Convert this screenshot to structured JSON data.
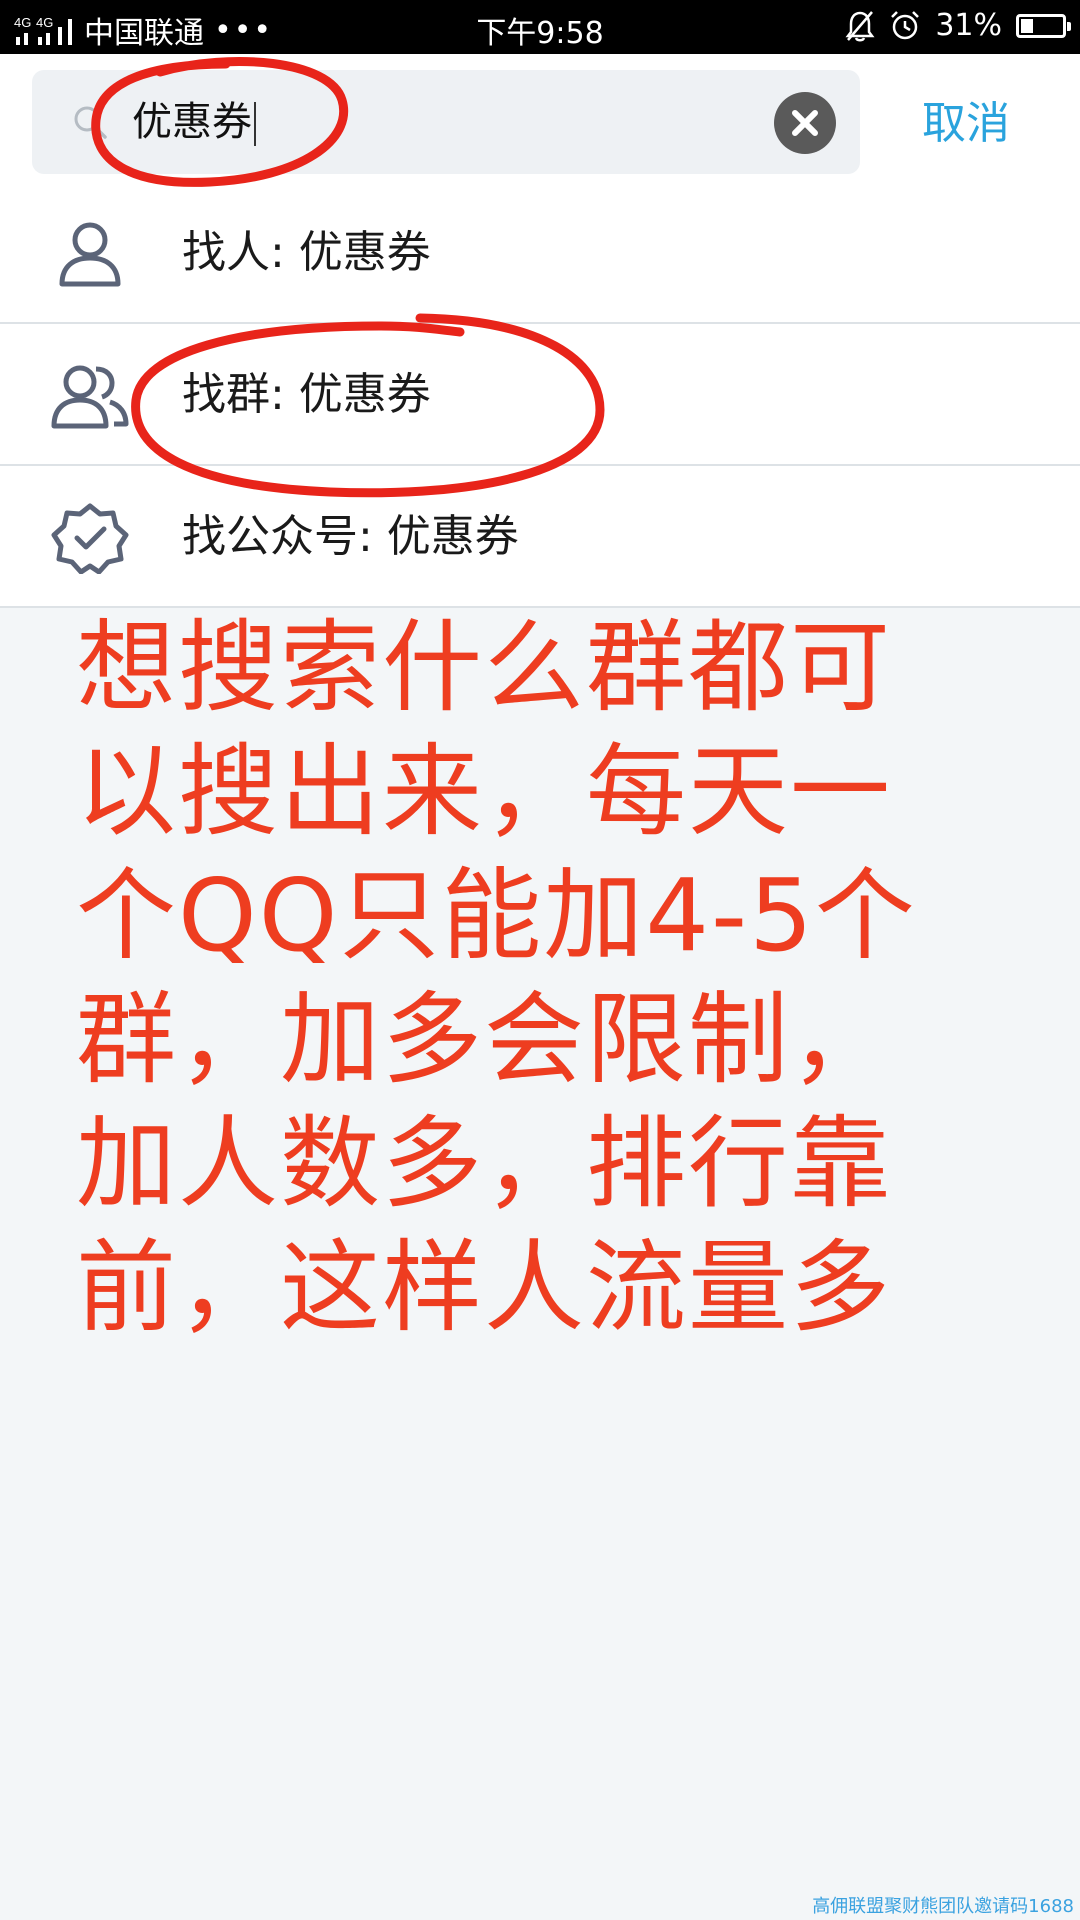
{
  "status_bar": {
    "network": "4G 4G",
    "carrier": "中国联通",
    "dots": "•••",
    "time": "下午9:58",
    "battery": "31%",
    "battery_level": 0.31
  },
  "search": {
    "query": "优惠券",
    "cancel_label": "取消"
  },
  "results": [
    {
      "label": "找人: 优惠券",
      "icon": "person-icon"
    },
    {
      "label": "找群: 优惠券",
      "icon": "group-icon"
    },
    {
      "label": "找公众号: 优惠券",
      "icon": "verified-badge-icon"
    }
  ],
  "annotation": {
    "lines": [
      "想搜索什么群都可",
      "以搜出来，每天一",
      "个QQ只能加4-5个",
      "群，加多会限制，",
      "加人数多，排行靠",
      "前，这样人流量多"
    ]
  },
  "watermark": "高佣联盟聚财熊团队邀请码1688",
  "colors": {
    "accent": "#2aa3dd",
    "annotation": "#ee3d20",
    "status_bar_bg": "#000000",
    "page_bg": "#f3f6f8"
  }
}
